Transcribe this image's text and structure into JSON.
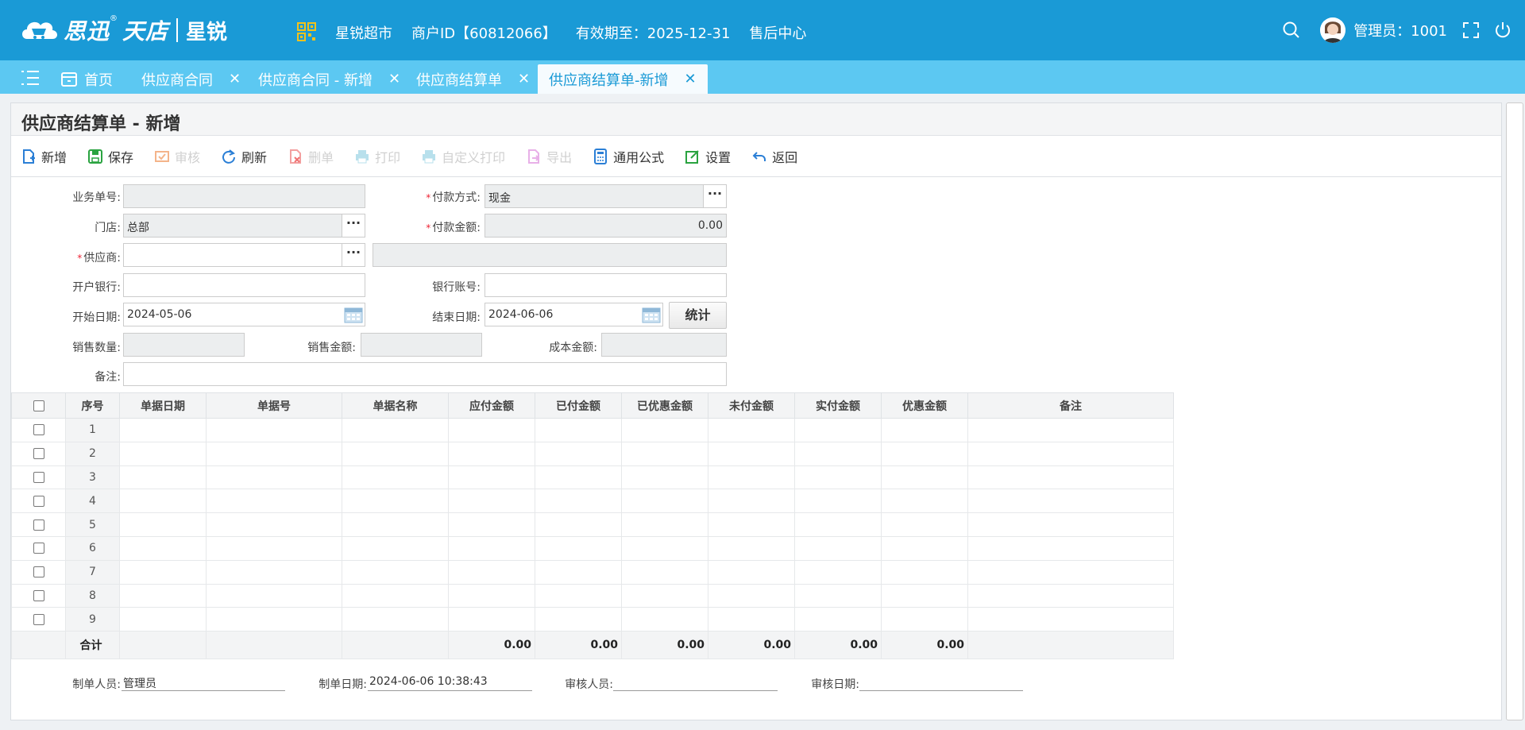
{
  "header": {
    "logo_text": "思迅",
    "logo_mark": "®",
    "logo_sub": "天店",
    "logo_brand": "星锐",
    "store_name": "星锐超市",
    "merchant_id": "商户ID【60812066】",
    "expiry": "有效期至：2025-12-31",
    "after_sales": "售后中心",
    "admin": "管理员：1001"
  },
  "tabs": [
    {
      "label": "首页"
    },
    {
      "label": "供应商合同",
      "close": "✕"
    },
    {
      "label": "供应商合同 - 新增",
      "close": "✕"
    },
    {
      "label": "供应商结算单",
      "close": "✕"
    },
    {
      "label": "供应商结算单-新增",
      "close": "✕"
    }
  ],
  "page_title": "供应商结算单 - 新增",
  "toolbar": {
    "add": "新增",
    "save": "保存",
    "audit": "审核",
    "refresh": "刷新",
    "delete": "删单",
    "print": "打印",
    "custom_print": "自定义打印",
    "export": "导出",
    "formula": "通用公式",
    "settings": "设置",
    "back": "返回"
  },
  "form": {
    "biz_no_label": "业务单号:",
    "biz_no": "",
    "pay_method_label": "付款方式:",
    "pay_method": "现金",
    "store_label": "门店:",
    "store": "总部",
    "pay_amount_label": "付款金额:",
    "pay_amount": "0.00",
    "supplier_label": "供应商:",
    "supplier": "",
    "bank_label": "开户银行:",
    "bank": "",
    "account_label": "银行账号:",
    "account": "",
    "start_date_label": "开始日期:",
    "start_date": "2024-05-06",
    "end_date_label": "结束日期:",
    "end_date": "2024-06-06",
    "stat_button": "统计",
    "sale_qty_label": "销售数量:",
    "sale_amount_label": "销售金额:",
    "cost_amount_label": "成本金额:",
    "remark_label": "备注:",
    "remark": "",
    "dots": "···"
  },
  "table": {
    "columns": [
      "序号",
      "单据日期",
      "单据号",
      "单据名称",
      "应付金额",
      "已付金额",
      "已优惠金额",
      "未付金额",
      "实付金额",
      "优惠金额",
      "备注"
    ],
    "rows": [
      "1",
      "2",
      "3",
      "4",
      "5",
      "6",
      "7",
      "8",
      "9"
    ],
    "total_label": "合计",
    "totals": [
      "0.00",
      "0.00",
      "0.00",
      "0.00",
      "0.00",
      "0.00"
    ]
  },
  "footer": {
    "maker_label": "制单人员:",
    "maker": "管理员",
    "make_date_label": "制单日期:",
    "make_date": "2024-06-06 10:38:43",
    "auditor_label": "审核人员:",
    "auditor": "",
    "audit_date_label": "审核日期:",
    "audit_date": ""
  },
  "colors": {
    "header_bg": "#1a9ad6",
    "tabbar_bg": "#5cc8f2",
    "active_tab_text": "#1a9ad6",
    "required": "#ee2233"
  }
}
